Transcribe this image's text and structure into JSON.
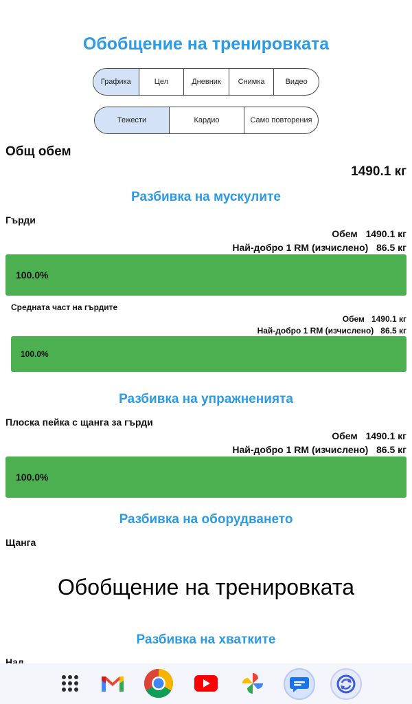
{
  "header": {
    "title": "Обобщение на тренировката"
  },
  "tabs_main": [
    {
      "label": "Графика",
      "selected": true
    },
    {
      "label": "Цел",
      "selected": false
    },
    {
      "label": "Дневник",
      "selected": false
    },
    {
      "label": "Снимка",
      "selected": false
    },
    {
      "label": "Видео",
      "selected": false
    }
  ],
  "tabs_type": [
    {
      "label": "Тежести",
      "selected": true
    },
    {
      "label": "Кардио",
      "selected": false
    },
    {
      "label": "Само повторения",
      "selected": false
    }
  ],
  "total_volume": {
    "label": "Общ обем",
    "value": "1490.1 кг"
  },
  "muscle_breakdown": {
    "heading": "Разбивка на мускулите",
    "group": {
      "name": "Гърди",
      "volume_label": "Обем",
      "volume_value": "1490.1 кг",
      "best_label": "Най-добро 1 RM (изчислено)",
      "best_value": "86.5 кг",
      "percent": "100.0%"
    },
    "sub": {
      "name": "Средната част на гърдите",
      "volume_label": "Обем",
      "volume_value": "1490.1 кг",
      "best_label": "Най-добро 1 RM (изчислено)",
      "best_value": "86.5 кг",
      "percent": "100.0%"
    }
  },
  "exercise_breakdown": {
    "heading": "Разбивка на упражненията",
    "item": {
      "name": "Плоска пейка с щанга за гърди",
      "volume_label": "Обем",
      "volume_value": "1490.1 кг",
      "best_label": "Най-добро 1 RM (изчислено)",
      "best_value": "86.5 кг",
      "percent": "100.0%"
    }
  },
  "equipment_breakdown": {
    "heading": "Разбивка на оборудването",
    "item_name": "Щанга"
  },
  "overlay_title": "Обобщение на тренировката",
  "grip_breakdown": {
    "heading": "Разбивка на хватките",
    "item_name_partial": "Над"
  },
  "colors": {
    "accent": "#2d9be3",
    "bar": "#4caf50",
    "selected_tab": "#d3e2f6"
  },
  "dock": [
    "apps-grid-icon",
    "gmail-icon",
    "chrome-icon",
    "youtube-icon",
    "photos-icon",
    "messages-icon",
    "sync-app-icon"
  ]
}
